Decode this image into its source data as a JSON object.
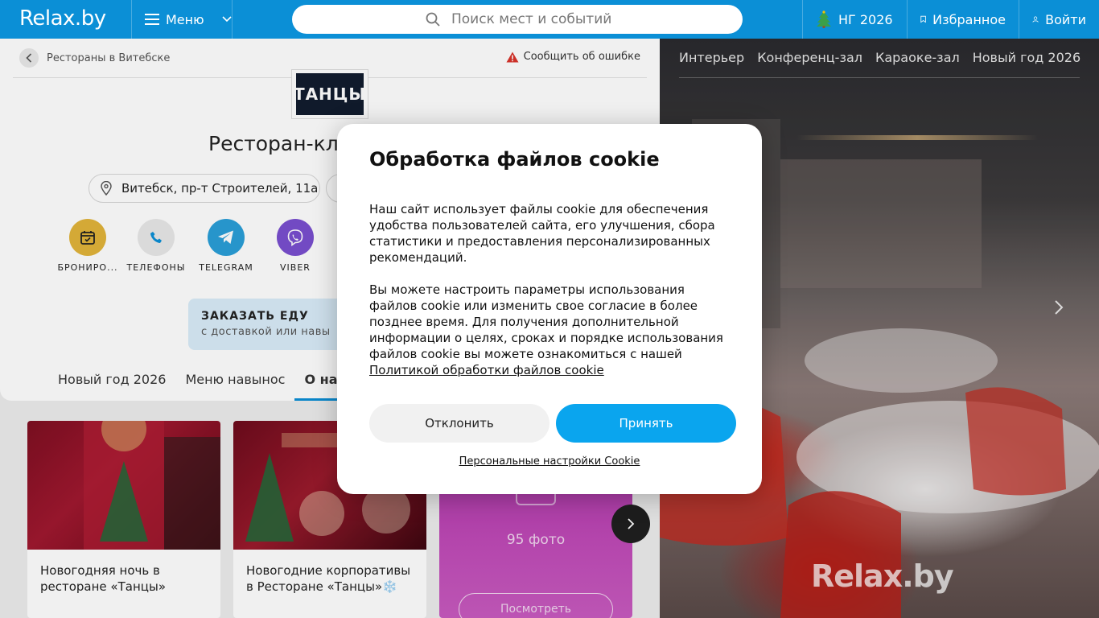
{
  "header": {
    "logo": "Relax.by",
    "menu_label": "Меню",
    "search_placeholder": "Поиск мест и событий",
    "ny_label": "НГ 2026",
    "favorites_label": "Избранное",
    "login_label": "Войти"
  },
  "place": {
    "breadcrumb": "Рестораны в Витебске",
    "report_label": "Сообщить об ошибке",
    "brand_logo_text": "ТАНЦЫ",
    "title": "Ресторан-клу",
    "address": "Витебск, пр-т Строителей, 11а",
    "actions": [
      {
        "label": "БРОНИРО...",
        "icon": "calendar-icon"
      },
      {
        "label": "ТЕЛЕФОНЫ",
        "icon": "phone-icon"
      },
      {
        "label": "TELEGRAM",
        "icon": "telegram-icon"
      },
      {
        "label": "VIBER",
        "icon": "viber-icon"
      }
    ],
    "order": {
      "title": "ЗАКАЗАТЬ ЕДУ",
      "subtitle": "с доставкой или навы"
    },
    "tabs": [
      "Новый год 2026",
      "Меню навынос",
      "О нас"
    ]
  },
  "cards": [
    {
      "caption": "Новогодняя ночь в ресторане «Танцы»"
    },
    {
      "caption": "Новогодние корпоративы в Ресторане «Танцы»❄️"
    }
  ],
  "photos_card": {
    "count_label": "95 фото",
    "button_label": "Посмотреть"
  },
  "gallery": {
    "tabs": [
      "Интерьер",
      "Конференц-зал",
      "Караоке-зал",
      "Новый год 2026"
    ],
    "watermark": "Relax.by"
  },
  "cookie": {
    "title": "Обработка файлов cookie",
    "paragraph1": "Наш сайт использует файлы cookie для обеспечения удобства пользователей сайта, его улучшения, сбора статистики и предоставления персонализированных рекомендаций.",
    "paragraph2": "Вы можете настроить параметры использования файлов cookie или изменить свое согласие в более позднее время. Для получения дополнительной информации о целях, сроках и порядке использования файлов cookie вы можете ознакомиться с нашей",
    "policy_link": "Политикой обработки файлов cookie",
    "decline_label": "Отклонить",
    "accept_label": "Принять",
    "personal_settings_label": "Персональные настройки Cookie"
  },
  "colors": {
    "brand": "#0b8fd6",
    "accept": "#0aa5ee",
    "telegram": "#2a9fd8",
    "viber": "#7a4fd0",
    "booking": "#e2b43a"
  }
}
